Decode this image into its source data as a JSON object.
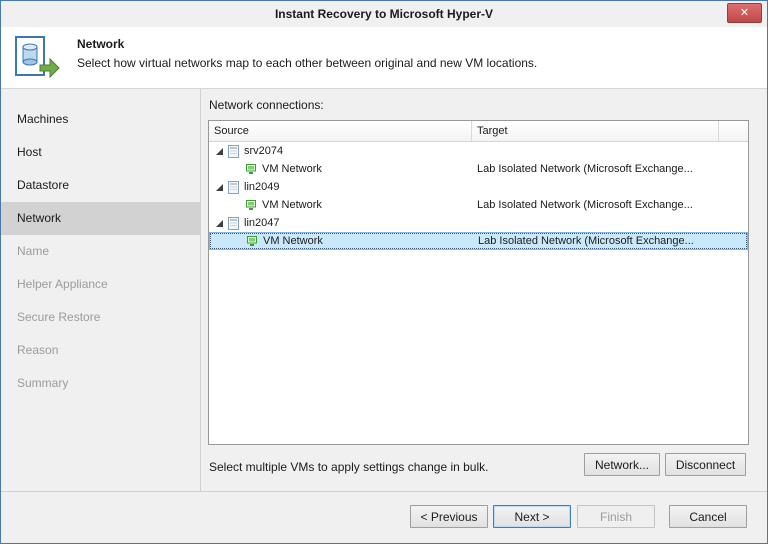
{
  "window": {
    "title": "Instant Recovery to Microsoft Hyper-V",
    "close_glyph": "✕"
  },
  "header": {
    "title": "Network",
    "subtitle": "Select how virtual networks map to each other between original and new VM locations."
  },
  "sidebar": {
    "items": [
      {
        "label": "Machines",
        "state": "enabled"
      },
      {
        "label": "Host",
        "state": "enabled"
      },
      {
        "label": "Datastore",
        "state": "enabled"
      },
      {
        "label": "Network",
        "state": "selected"
      },
      {
        "label": "Name",
        "state": "disabled"
      },
      {
        "label": "Helper Appliance",
        "state": "disabled"
      },
      {
        "label": "Secure Restore",
        "state": "disabled"
      },
      {
        "label": "Reason",
        "state": "disabled"
      },
      {
        "label": "Summary",
        "state": "disabled"
      }
    ]
  },
  "main": {
    "list_label": "Network connections:",
    "table": {
      "columns": [
        "Source",
        "Target"
      ],
      "rows": [
        {
          "type": "group",
          "label": "srv2074"
        },
        {
          "type": "network",
          "source": "VM Network",
          "target": "Lab Isolated Network (Microsoft Exchange...",
          "selected": false
        },
        {
          "type": "group",
          "label": "lin2049"
        },
        {
          "type": "network",
          "source": "VM Network",
          "target": "Lab Isolated Network (Microsoft Exchange...",
          "selected": false
        },
        {
          "type": "group",
          "label": "lin2047"
        },
        {
          "type": "network",
          "source": "VM Network",
          "target": "Lab Isolated Network (Microsoft Exchange...",
          "selected": true
        }
      ]
    },
    "hint": "Select multiple VMs to apply settings change in bulk.",
    "buttons": {
      "network": "Network...",
      "disconnect": "Disconnect"
    }
  },
  "footer": {
    "previous": "< Previous",
    "next": "Next >",
    "finish": "Finish",
    "cancel": "Cancel"
  },
  "colors": {
    "window_border": "#4a77ad",
    "selection_bg": "#cbe8fa",
    "selection_border": "#86b6e0",
    "close_button": "#c04848",
    "disabled_text": "#9b9b9b"
  }
}
